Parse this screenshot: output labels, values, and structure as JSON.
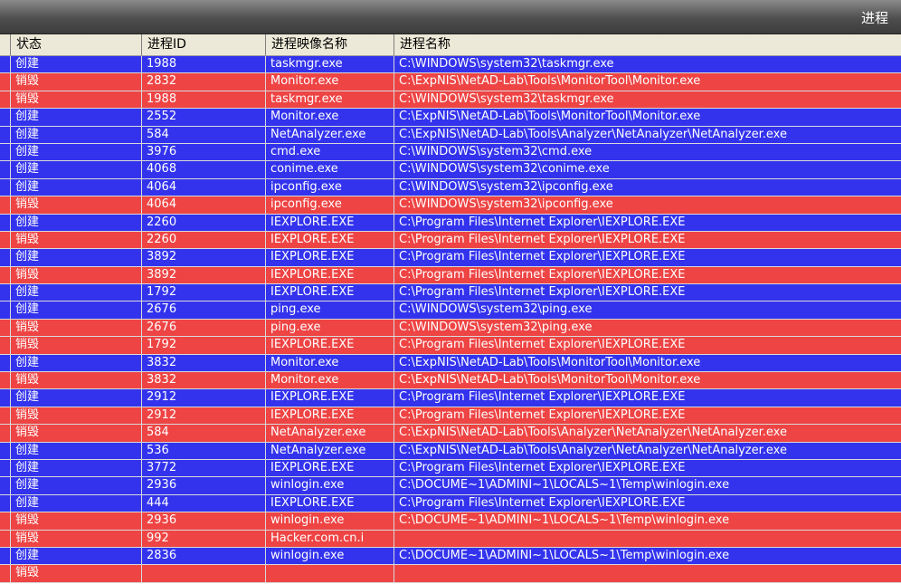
{
  "window": {
    "title": "进程"
  },
  "columns": [
    "状态",
    "进程ID",
    "进程映像名称",
    "进程名称"
  ],
  "rows": [
    {
      "status": "创建",
      "pid": "1988",
      "image": "taskmgr.exe",
      "path": "C:\\WINDOWS\\system32\\taskmgr.exe",
      "color": "blue"
    },
    {
      "status": "销毁",
      "pid": "2832",
      "image": "Monitor.exe",
      "path": "C:\\ExpNIS\\NetAD-Lab\\Tools\\MonitorTool\\Monitor.exe",
      "color": "red"
    },
    {
      "status": "销毁",
      "pid": "1988",
      "image": "taskmgr.exe",
      "path": "C:\\WINDOWS\\system32\\taskmgr.exe",
      "color": "red"
    },
    {
      "status": "创建",
      "pid": "2552",
      "image": "Monitor.exe",
      "path": "C:\\ExpNIS\\NetAD-Lab\\Tools\\MonitorTool\\Monitor.exe",
      "color": "blue"
    },
    {
      "status": "创建",
      "pid": "584",
      "image": "NetAnalyzer.exe",
      "path": "C:\\ExpNIS\\NetAD-Lab\\Tools\\Analyzer\\NetAnalyzer\\NetAnalyzer.exe",
      "color": "blue"
    },
    {
      "status": "创建",
      "pid": "3976",
      "image": "cmd.exe",
      "path": "C:\\WINDOWS\\system32\\cmd.exe",
      "color": "blue"
    },
    {
      "status": "创建",
      "pid": "4068",
      "image": "conime.exe",
      "path": "C:\\WINDOWS\\system32\\conime.exe",
      "color": "blue"
    },
    {
      "status": "创建",
      "pid": "4064",
      "image": "ipconfig.exe",
      "path": "C:\\WINDOWS\\system32\\ipconfig.exe",
      "color": "blue"
    },
    {
      "status": "销毁",
      "pid": "4064",
      "image": "ipconfig.exe",
      "path": "C:\\WINDOWS\\system32\\ipconfig.exe",
      "color": "red"
    },
    {
      "status": "创建",
      "pid": "2260",
      "image": "IEXPLORE.EXE",
      "path": "C:\\Program Files\\Internet Explorer\\IEXPLORE.EXE",
      "color": "blue"
    },
    {
      "status": "销毁",
      "pid": "2260",
      "image": "IEXPLORE.EXE",
      "path": "C:\\Program Files\\Internet Explorer\\IEXPLORE.EXE",
      "color": "red"
    },
    {
      "status": "创建",
      "pid": "3892",
      "image": "IEXPLORE.EXE",
      "path": "C:\\Program Files\\Internet Explorer\\IEXPLORE.EXE",
      "color": "blue"
    },
    {
      "status": "销毁",
      "pid": "3892",
      "image": "IEXPLORE.EXE",
      "path": "C:\\Program Files\\Internet Explorer\\IEXPLORE.EXE",
      "color": "red"
    },
    {
      "status": "创建",
      "pid": "1792",
      "image": "IEXPLORE.EXE",
      "path": "C:\\Program Files\\Internet Explorer\\IEXPLORE.EXE",
      "color": "blue"
    },
    {
      "status": "创建",
      "pid": "2676",
      "image": "ping.exe",
      "path": "C:\\WINDOWS\\system32\\ping.exe",
      "color": "blue"
    },
    {
      "status": "销毁",
      "pid": "2676",
      "image": "ping.exe",
      "path": "C:\\WINDOWS\\system32\\ping.exe",
      "color": "red"
    },
    {
      "status": "销毁",
      "pid": "1792",
      "image": "IEXPLORE.EXE",
      "path": "C:\\Program Files\\Internet Explorer\\IEXPLORE.EXE",
      "color": "red"
    },
    {
      "status": "创建",
      "pid": "3832",
      "image": "Monitor.exe",
      "path": "C:\\ExpNIS\\NetAD-Lab\\Tools\\MonitorTool\\Monitor.exe",
      "color": "blue"
    },
    {
      "status": "销毁",
      "pid": "3832",
      "image": "Monitor.exe",
      "path": "C:\\ExpNIS\\NetAD-Lab\\Tools\\MonitorTool\\Monitor.exe",
      "color": "red"
    },
    {
      "status": "创建",
      "pid": "2912",
      "image": "IEXPLORE.EXE",
      "path": "C:\\Program Files\\Internet Explorer\\IEXPLORE.EXE",
      "color": "blue"
    },
    {
      "status": "销毁",
      "pid": "2912",
      "image": "IEXPLORE.EXE",
      "path": "C:\\Program Files\\Internet Explorer\\IEXPLORE.EXE",
      "color": "red"
    },
    {
      "status": "销毁",
      "pid": "584",
      "image": "NetAnalyzer.exe",
      "path": "C:\\ExpNIS\\NetAD-Lab\\Tools\\Analyzer\\NetAnalyzer\\NetAnalyzer.exe",
      "color": "red"
    },
    {
      "status": "创建",
      "pid": "536",
      "image": "NetAnalyzer.exe",
      "path": "C:\\ExpNIS\\NetAD-Lab\\Tools\\Analyzer\\NetAnalyzer\\NetAnalyzer.exe",
      "color": "blue"
    },
    {
      "status": "创建",
      "pid": "3772",
      "image": "IEXPLORE.EXE",
      "path": "C:\\Program Files\\Internet Explorer\\IEXPLORE.EXE",
      "color": "blue"
    },
    {
      "status": "创建",
      "pid": "2936",
      "image": "winlogin.exe",
      "path": "C:\\DOCUME~1\\ADMINI~1\\LOCALS~1\\Temp\\winlogin.exe",
      "color": "blue"
    },
    {
      "status": "创建",
      "pid": "444",
      "image": "IEXPLORE.EXE",
      "path": "C:\\Program Files\\Internet Explorer\\IEXPLORE.EXE",
      "color": "blue"
    },
    {
      "status": "销毁",
      "pid": "2936",
      "image": "winlogin.exe",
      "path": "C:\\DOCUME~1\\ADMINI~1\\LOCALS~1\\Temp\\winlogin.exe",
      "color": "red"
    },
    {
      "status": "销毁",
      "pid": "992",
      "image": "Hacker.com.cn.i",
      "path": "",
      "color": "red"
    },
    {
      "status": "创建",
      "pid": "2836",
      "image": "winlogin.exe",
      "path": "C:\\DOCUME~1\\ADMINI~1\\LOCALS~1\\Temp\\winlogin.exe",
      "color": "blue"
    },
    {
      "status": "销毁",
      "pid": "",
      "image": "",
      "path": "",
      "color": "red"
    }
  ],
  "colors": {
    "create_row": "#3333ee",
    "destroy_row": "#ee4444",
    "header_bg": "#ece9d8"
  }
}
